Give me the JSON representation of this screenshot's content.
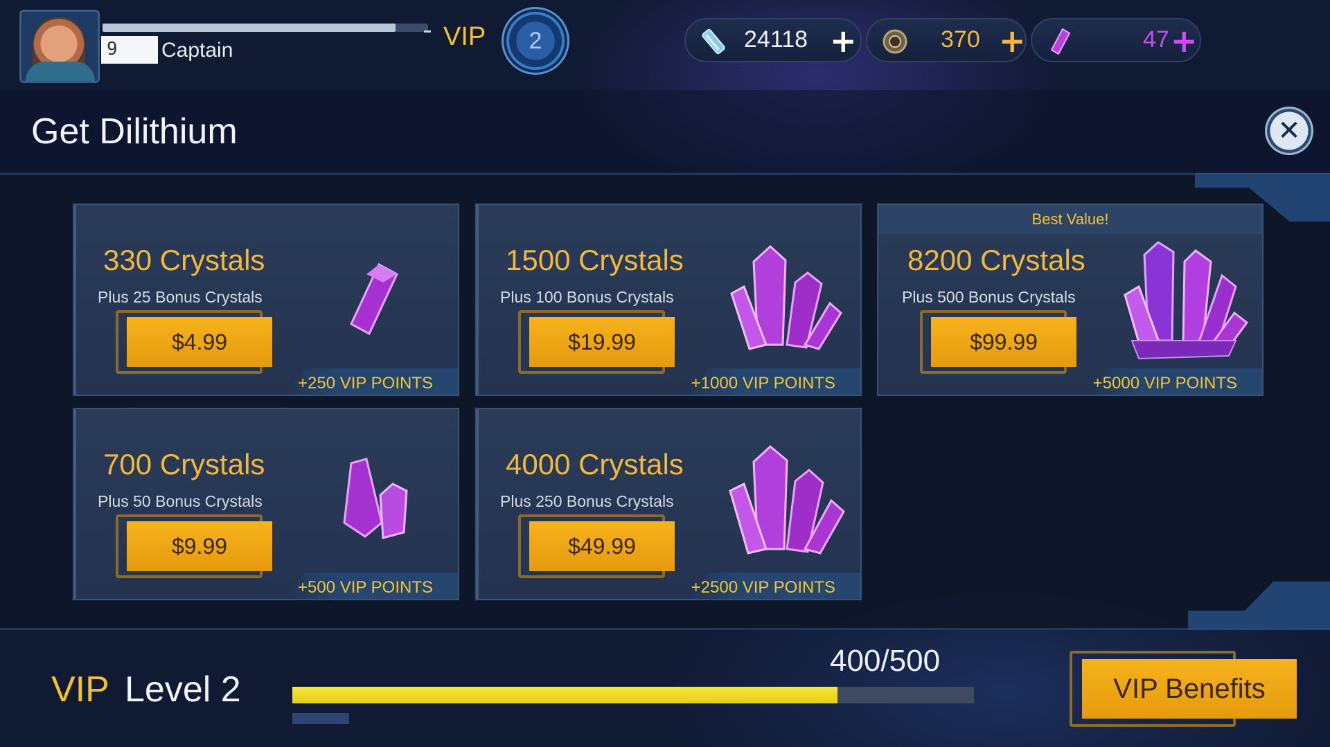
{
  "player": {
    "level": "9",
    "rank": "Captain",
    "xp_progress": 0.9
  },
  "vip": {
    "label": "VIP",
    "badge": "2"
  },
  "resources": [
    {
      "icon": "latinum-bar-icon",
      "value": "24118",
      "plus": "+"
    },
    {
      "icon": "parsteel-icon",
      "value": "370",
      "plus": "+"
    },
    {
      "icon": "dilithium-crystal-icon",
      "value": "47",
      "plus": "+"
    }
  ],
  "page_title": "Get Dilithium",
  "close_icon": "close-icon",
  "offers": [
    {
      "title": "330 Crystals",
      "bonus": "Plus 25 Bonus Crystals",
      "price": "$4.99",
      "vip_points": "+250 VIP POINTS",
      "crystal_icon": "single-crystal-icon"
    },
    {
      "title": "1500 Crystals",
      "bonus": "Plus 100 Bonus Crystals",
      "price": "$19.99",
      "vip_points": "+1000 VIP POINTS",
      "crystal_icon": "crystal-cluster-icon"
    },
    {
      "title": "8200 Crystals",
      "bonus": "Plus 500 Bonus Crystals",
      "price": "$99.99",
      "vip_points": "+5000 VIP POINTS",
      "badge": "Best Value!",
      "crystal_icon": "large-crystal-cluster-icon"
    },
    {
      "title": "700 Crystals",
      "bonus": "Plus 50 Bonus Crystals",
      "price": "$9.99",
      "vip_points": "+500 VIP POINTS",
      "crystal_icon": "double-crystal-icon"
    },
    {
      "title": "4000 Crystals",
      "bonus": "Plus 250 Bonus Crystals",
      "price": "$49.99",
      "vip_points": "+2500 VIP POINTS",
      "crystal_icon": "crystal-cluster-icon"
    }
  ],
  "footer": {
    "vip_label": "VIP",
    "level_label": "Level 2",
    "progress_text": "400/500",
    "progress_fraction": 0.8,
    "benefits_button": "VIP Benefits"
  },
  "colors": {
    "accent_gold": "#f2b83b",
    "button_orange": "#f6b31c",
    "crystal_purple": "#b93ee0",
    "progress_yellow": "#f7e53a"
  }
}
